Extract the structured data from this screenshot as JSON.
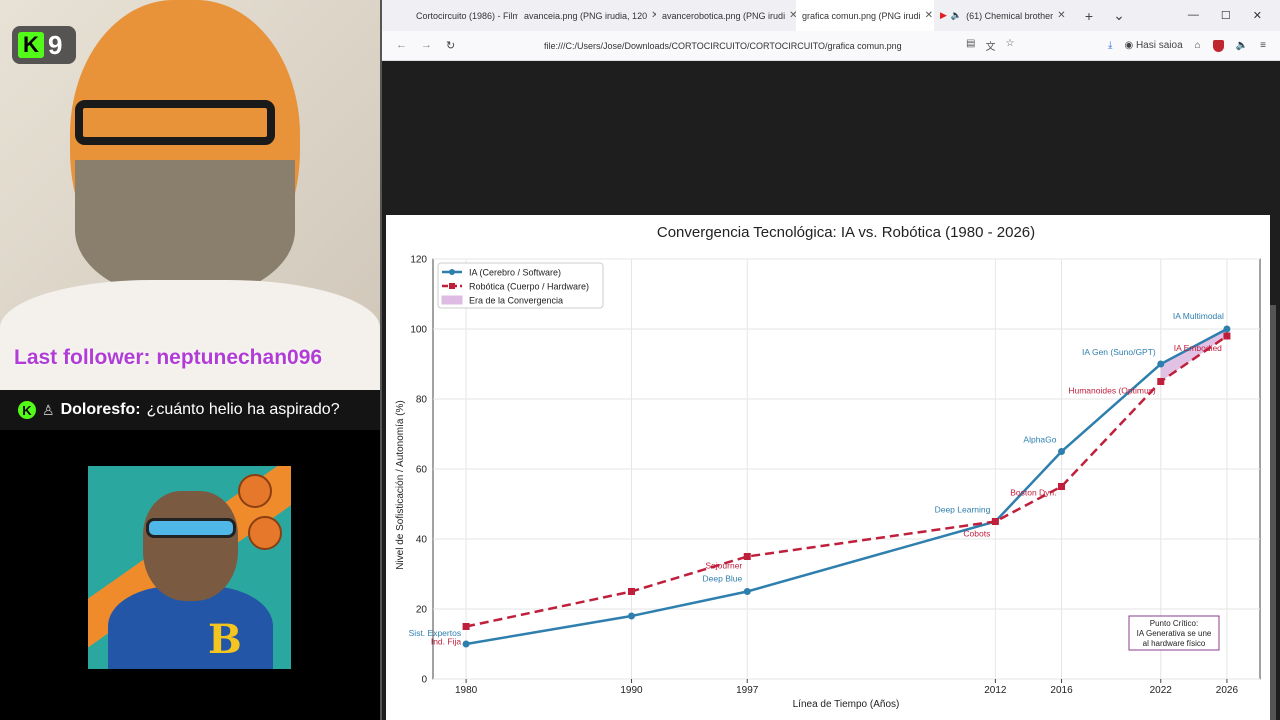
{
  "stream": {
    "badge_count": "9",
    "kick_glyph": "K",
    "follower_text": "Last follower: neptunechan096",
    "chat_user": "Doloresfo:",
    "chat_message": "¿cuánto helio ha aspirado?",
    "wolf_letter": "B"
  },
  "browser": {
    "tabs": [
      {
        "label": "Cortocircuito (1986) - Film"
      },
      {
        "label": "avanceia.png (PNG irudia, 120"
      },
      {
        "label": "avancerobotica.png (PNG irudi"
      },
      {
        "label": "grafica comun.png (PNG irudi"
      },
      {
        "label": "(61) Chemical brother"
      }
    ],
    "address": "file:///C:/Users/Jose/Downloads/CORTOCIRCUITO/CORTOCIRCUITO/grafica comun.png",
    "profile_label": "Hasi saioa"
  },
  "chart_data": {
    "type": "line",
    "title": "Convergencia Tecnológica: IA vs. Robótica (1980 - 2026)",
    "xlabel": "Línea de Tiempo (Años)",
    "ylabel": "Nivel de Sofisticación / Autonomía (%)",
    "x": [
      1980,
      1990,
      1997,
      2012,
      2016,
      2022,
      2026
    ],
    "xticks": [
      "1980",
      "1990",
      "1997",
      "2012",
      "2016",
      "2022",
      "2026"
    ],
    "ylim": [
      0,
      120
    ],
    "yticks": [
      "0",
      "20",
      "40",
      "60",
      "80",
      "100",
      "120"
    ],
    "grid": true,
    "legend_position": "top-left",
    "colors": {
      "ia": "#2e7fae",
      "robotica": "#c01f3c",
      "convergencia": "#c98fcf"
    },
    "series": [
      {
        "name": "IA (Cerebro / Software)",
        "key": "ia",
        "style": "solid",
        "values": [
          10,
          18,
          25,
          45,
          65,
          90,
          100
        ]
      },
      {
        "name": "Robótica (Cuerpo / Hardware)",
        "key": "robotica",
        "style": "dashed",
        "values": [
          15,
          25,
          35,
          45,
          55,
          85,
          98
        ]
      }
    ],
    "band": {
      "name": "Era de la Convergencia",
      "from": 2022,
      "to": 2026
    },
    "annotations": [
      {
        "text": "Sist. Expertos",
        "x": 1980,
        "y": 10,
        "series": "ia"
      },
      {
        "text": "Deep Blue",
        "x": 1997,
        "y": 25,
        "series": "ia"
      },
      {
        "text": "Deep Learning",
        "x": 2012,
        "y": 45,
        "series": "ia"
      },
      {
        "text": "AlphaGo",
        "x": 2016,
        "y": 65,
        "series": "ia"
      },
      {
        "text": "IA Gen (Suno/GPT)",
        "x": 2022,
        "y": 90,
        "series": "ia"
      },
      {
        "text": "IA Multimodal",
        "x": 2026,
        "y": 100,
        "series": "ia"
      },
      {
        "text": "Ind. Fija",
        "x": 1980,
        "y": 15,
        "series": "robotica"
      },
      {
        "text": "Sojourner",
        "x": 1997,
        "y": 35,
        "series": "robotica"
      },
      {
        "text": "Cobots",
        "x": 2012,
        "y": 45,
        "series": "robotica"
      },
      {
        "text": "Boston Dyn.",
        "x": 2016,
        "y": 55,
        "series": "robotica"
      },
      {
        "text": "Humanoides (Optimus)",
        "x": 2022,
        "y": 85,
        "series": "robotica"
      },
      {
        "text": "IA Embodied",
        "x": 2026,
        "y": 98,
        "series": "robotica"
      }
    ],
    "callout": [
      "Punto Crítico:",
      "IA Generativa se une",
      "al hardware físico"
    ]
  }
}
